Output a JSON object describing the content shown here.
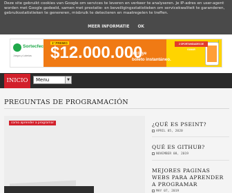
{
  "cookie_bar": {
    "text": "Deze site gebruikt cookies van Google om services te leveren en verkeer te analyseren. Je IP-adres en user-agent worden met Google gedeeld, samen met prestatie- en beveiligingsstatistieken om servicekwaliteit te garanderen, gebruiksstatistieken te genereren, misbruik te detecteren en maatregelen te treffen.",
    "more_info": "MEER INFORMATIE",
    "ok": "OK"
  },
  "ad": {
    "brand": "Sortecfec",
    "brand_sub": "Juegos y Loterías",
    "prize_label": "1° PREMIO",
    "amount": "$12.000.000",
    "chances": "2 OPORTUNIDADES DE GANAR",
    "line1": "Incluye",
    "line2": "boleto instantáneo.",
    "info_icon": "i"
  },
  "nav": {
    "home": "INICIO",
    "menu_selected": "Menu",
    "dropdown_icon": "chevron-down-icon"
  },
  "main": {
    "section_title": "PREGUNTAS DE PROGRAMACIÓN",
    "post_label": "como aprender a programar"
  },
  "sidebar": {
    "items": [
      {
        "title": "¿QUÉ ES PSEINT?",
        "date": "APRIL 05, 2020"
      },
      {
        "title": "QUÉ ES GITHUB?",
        "date": "NOVEMBER 08, 2019"
      },
      {
        "title": "MEJORES PAGINAS WEBS PARA APRENDER A PROGRAMAR",
        "date": "MAY 07, 2019"
      }
    ]
  },
  "colors": {
    "accent": "#d2202b",
    "navbar": "#2b2b2b",
    "cookie_bar": "#4a4a4a",
    "ad_orange": "#f07a14",
    "ad_yellow": "#ffd400"
  }
}
